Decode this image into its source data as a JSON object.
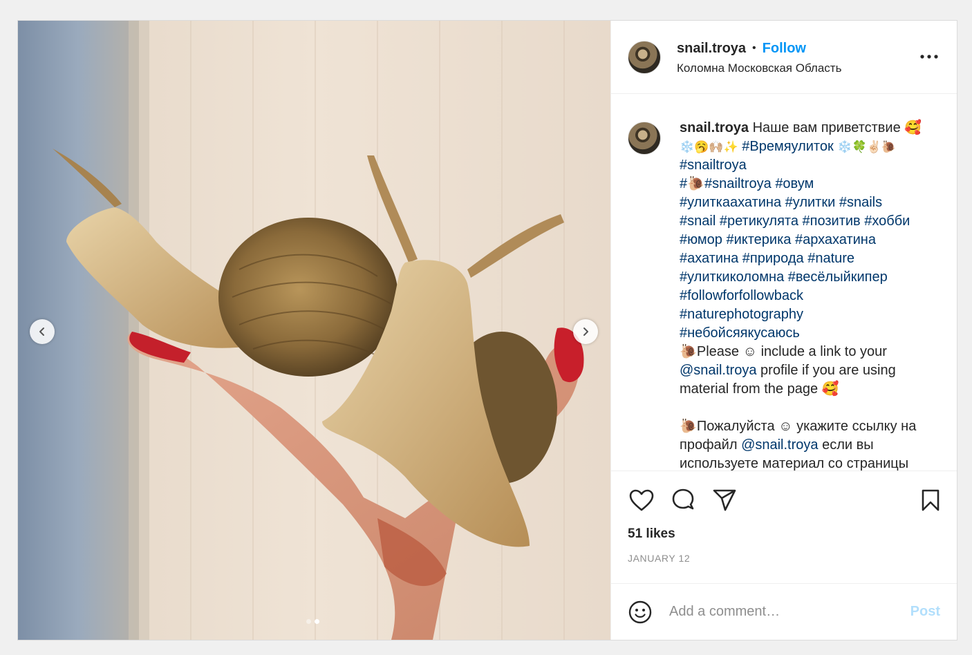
{
  "post": {
    "username": "snail.troya",
    "separator": "•",
    "follow_label": "Follow",
    "location": "Коломна Московская Область"
  },
  "caption": {
    "username": "snail.troya",
    "text_intro": "Наше вам приветствие 🥰",
    "line2_emoji": "❄️🥱🙌🏼✨",
    "tag_vremya": "#Времяулиток",
    "line2_emoji_end": "❄️🍀✌🏻🐌",
    "tag_snailtroya": "#snailtroya",
    "line4_emoji": "#🐌",
    "tag_snailtroya2": "#snailtroya",
    "tag_ovum": "#овум",
    "tag_ulitkaahatina": "#улиткаахатина",
    "tag_ulitki": "#улитки",
    "tag_snails": "#snails",
    "tag_snail": "#snail",
    "tag_retikulyata": "#ретикулята",
    "tag_pozitiv": "#позитив",
    "tag_hobbi": "#хобби",
    "tag_yumor": "#юмор",
    "tag_ikterika": "#иктерика",
    "tag_arhahatina": "#архахатина",
    "tag_ahatina": "#ахатина",
    "tag_priroda": "#природа",
    "tag_nature": "#nature",
    "tag_ulitkikolomna": "#улиткиколомна",
    "tag_veselykiper": "#весёлыйкипер",
    "tag_followforfollowback": "#followforfollowback",
    "tag_naturephotography": "#naturephotography",
    "tag_neboisya": "#небойсяякусаюсь",
    "en_p1": "🐌Please ☺ include a link to your",
    "mention": "@snail.troya",
    "en_p2": "profile if you are using material from the page 🥰",
    "ru_p1": "🐌Пожалуйста ☺ укажите ссылку на профайл",
    "mention2": "@snail.troya",
    "ru_p2": "если вы используете материал со страницы"
  },
  "icons": {
    "like": "heart-icon",
    "comment": "comment-icon",
    "share": "share-icon",
    "save": "bookmark-icon",
    "more": "more-options-icon",
    "emoji": "emoji-icon",
    "prev": "chevron-left-icon",
    "next": "chevron-right-icon"
  },
  "stats": {
    "likes": "51 likes",
    "date": "JANUARY 12"
  },
  "comment": {
    "placeholder": "Add a comment…",
    "post_label": "Post"
  },
  "carousel": {
    "total": 2,
    "active_index": 2
  },
  "colors": {
    "follow": "#0095f6",
    "hashtag": "#00376b",
    "post_disabled": "#b2dffc",
    "muted": "#8e8e8e"
  }
}
